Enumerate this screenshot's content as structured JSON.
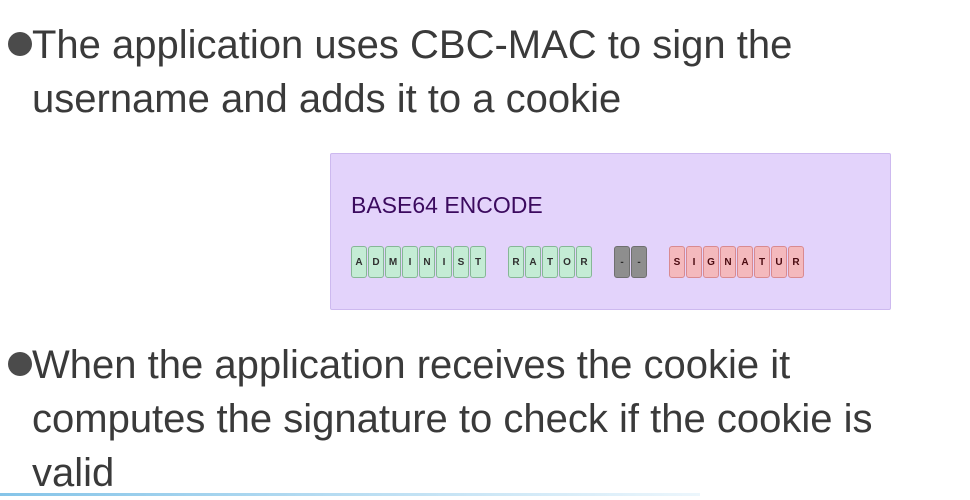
{
  "bullets": [
    {
      "text": "The application uses CBC-MAC to sign the\nusername and adds it to a cookie"
    },
    {
      "text": "When the application receives the cookie it\ncomputes the signature to check if the cookie is\nvalid"
    }
  ],
  "diagram": {
    "title": "BASE64 ENCODE",
    "blocks": [
      {
        "name": "block-administ",
        "style": "green",
        "cells": [
          "A",
          "D",
          "M",
          "I",
          "N",
          "I",
          "S",
          "T"
        ]
      },
      {
        "name": "block-rator",
        "style": "green",
        "cells": [
          "R",
          "A",
          "T",
          "O",
          "R"
        ]
      },
      {
        "name": "block-separator",
        "style": "gray",
        "cells": [
          "-",
          "-"
        ]
      },
      {
        "name": "block-signatur",
        "style": "red",
        "cells": [
          "S",
          "I",
          "G",
          "N",
          "A",
          "T",
          "U",
          "R"
        ]
      }
    ]
  },
  "colors": {
    "green_cell": "#c4ecd5",
    "gray_cell": "#8e8e8e",
    "red_cell": "#f4b9bd",
    "diagram_bg": "#e3d3fb"
  }
}
